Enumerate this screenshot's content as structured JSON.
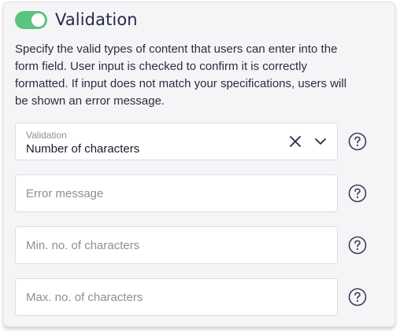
{
  "section": {
    "title": "Validation",
    "toggle_on": true,
    "toggle_color": "#5cc47f",
    "description": "Specify the valid types of content that users can enter into the form field. User input is checked to confirm it is correctly formatted. If input does not match your specifications, users will be shown an error message."
  },
  "validation_select": {
    "label": "Validation",
    "value": "Number of characters"
  },
  "fields": {
    "error_message_placeholder": "Error message",
    "min_chars_placeholder": "Min. no. of characters",
    "max_chars_placeholder": "Max. no. of characters"
  },
  "icons": {
    "help": "help-circle-icon",
    "clear": "close-icon",
    "expand": "chevron-down-icon"
  }
}
